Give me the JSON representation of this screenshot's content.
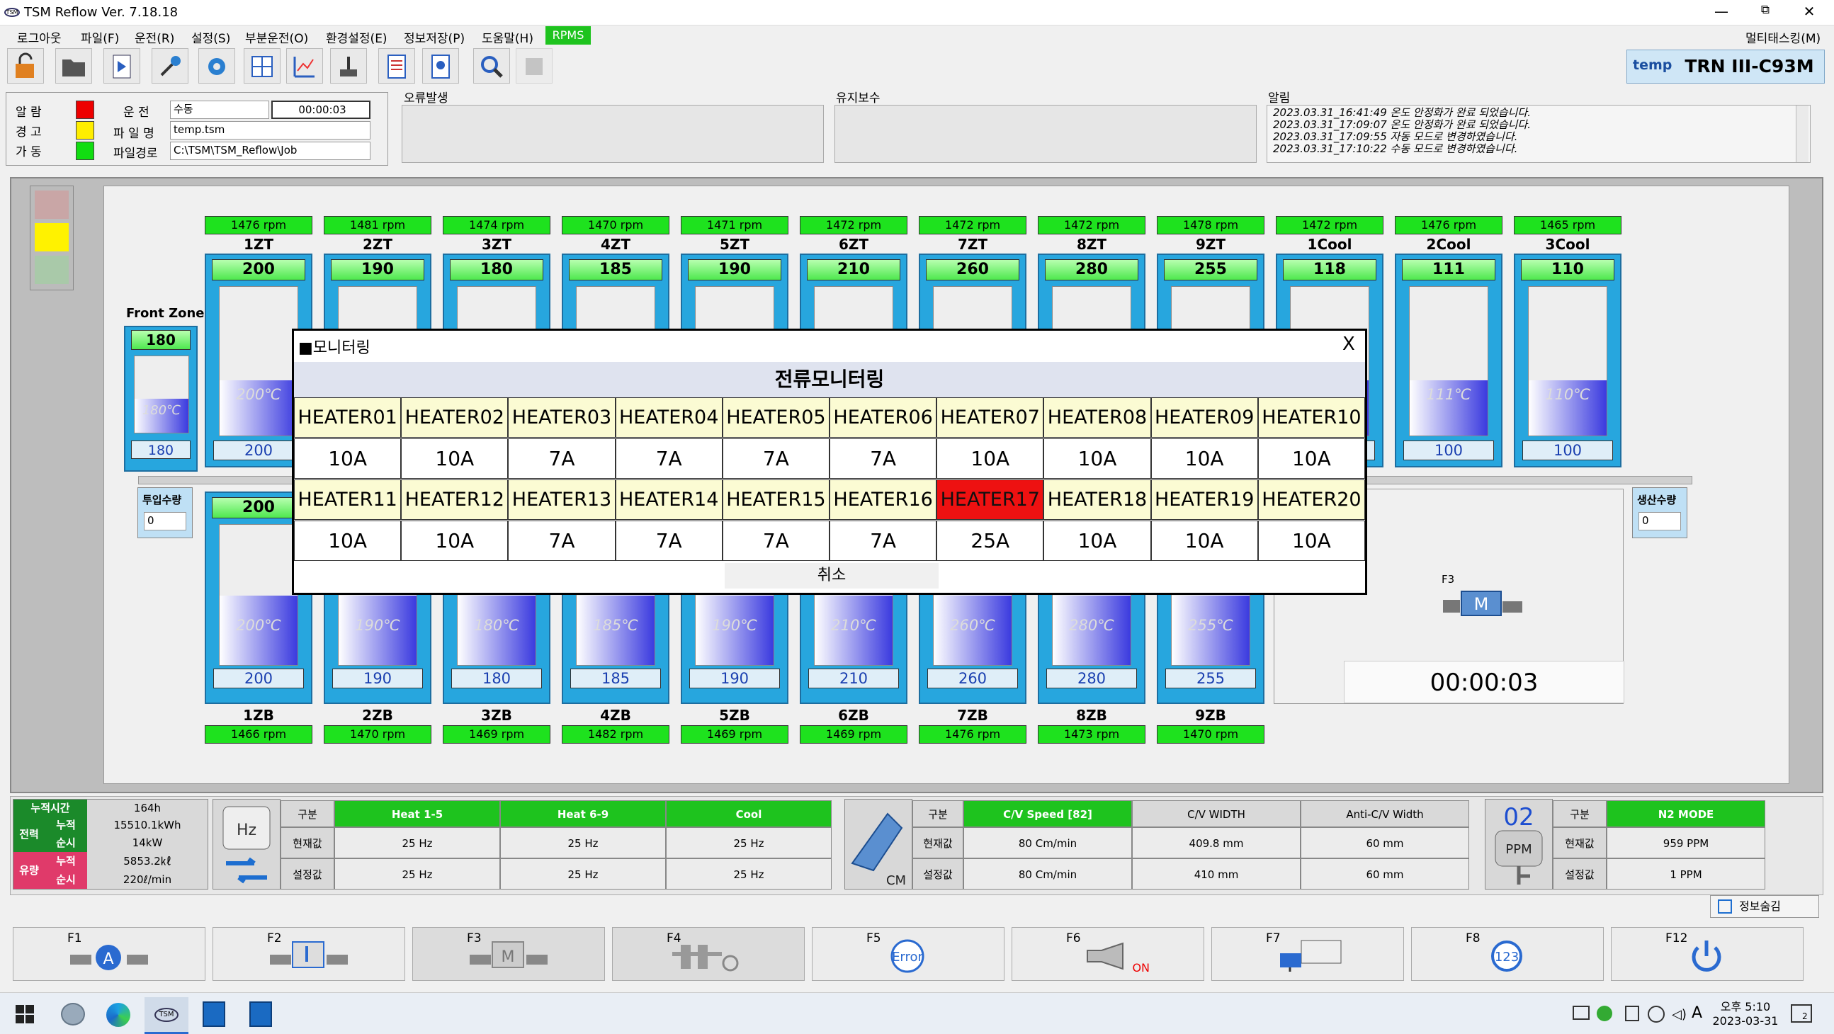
{
  "window": {
    "title": "TSM Reflow Ver. 7.18.18",
    "logo": "TSM",
    "minimize": "—",
    "restore": "⧉",
    "close": "✕"
  },
  "menu": [
    "로그아웃",
    "파일(F)",
    "운전(R)",
    "설정(S)",
    "부분운전(O)",
    "환경설정(E)",
    "정보저장(P)",
    "도움말(H)"
  ],
  "menu_rpms": "RPMS",
  "menu_right": "멀티태스킹(M)",
  "model": {
    "tag": "temp",
    "name": "TRN III-C93M"
  },
  "status": {
    "alarm_label": "알  람",
    "warn_label": "경  고",
    "run_label": "가  동",
    "op_label": "운  전",
    "op_value": "수동",
    "timer": "00:00:03",
    "file_label": "파 일 명",
    "file_value": "temp.tsm",
    "path_label": "파일경로",
    "path_value": "C:\\TSM\\TSM_Reflow\\Job"
  },
  "boxes": {
    "error": "오류발생",
    "maint": "유지보수",
    "notice": "알림"
  },
  "notices": [
    "2023.03.31_16:41:49  온도 안정화가 완료 되었습니다.",
    "2023.03.31_17:09:07  온도 안정화가 완료 되었습니다.",
    "2023.03.31_17:09:55  자동 모드로 변경하였습니다.",
    "2023.03.31_17:10:22  수동 모드로 변경하였습니다."
  ],
  "colors": {
    "alarm": "#ee0000",
    "warn": "#ffee00",
    "run": "#11dd11",
    "rpm": "#1ee21e"
  },
  "front_zone": {
    "label": "Front Zone",
    "sp": "180",
    "pv_text": "180℃",
    "pv": "180"
  },
  "top_zones": [
    {
      "rpm": "1476 rpm",
      "name": "1ZT",
      "sp": "200",
      "pv_text": "200℃",
      "pv": "200"
    },
    {
      "rpm": "1481 rpm",
      "name": "2ZT",
      "sp": "190",
      "pv_text": "",
      "pv": ""
    },
    {
      "rpm": "1474 rpm",
      "name": "3ZT",
      "sp": "180",
      "pv_text": "",
      "pv": ""
    },
    {
      "rpm": "1470 rpm",
      "name": "4ZT",
      "sp": "185",
      "pv_text": "",
      "pv": ""
    },
    {
      "rpm": "1471 rpm",
      "name": "5ZT",
      "sp": "190",
      "pv_text": "",
      "pv": ""
    },
    {
      "rpm": "1472 rpm",
      "name": "6ZT",
      "sp": "210",
      "pv_text": "",
      "pv": ""
    },
    {
      "rpm": "1472 rpm",
      "name": "7ZT",
      "sp": "260",
      "pv_text": "",
      "pv": ""
    },
    {
      "rpm": "1472 rpm",
      "name": "8ZT",
      "sp": "280",
      "pv_text": "",
      "pv": ""
    },
    {
      "rpm": "1478 rpm",
      "name": "9ZT",
      "sp": "255",
      "pv_text": "",
      "pv": ""
    },
    {
      "rpm": "1472 rpm",
      "name": "1Cool",
      "sp": "118",
      "pv_text": "",
      "pv": ""
    },
    {
      "rpm": "1476 rpm",
      "name": "2Cool",
      "sp": "111",
      "pv_text": "111℃",
      "pv": "100"
    },
    {
      "rpm": "1465 rpm",
      "name": "3Cool",
      "sp": "110",
      "pv_text": "110℃",
      "pv": "100"
    }
  ],
  "bottom_zones": [
    {
      "rpm": "1466 rpm",
      "name": "1ZB",
      "sp": "200",
      "pv_text": "200℃",
      "pv": "200"
    },
    {
      "rpm": "1470 rpm",
      "name": "2ZB",
      "sp": "",
      "pv_text": "190℃",
      "pv": "190"
    },
    {
      "rpm": "1469 rpm",
      "name": "3ZB",
      "sp": "",
      "pv_text": "180℃",
      "pv": "180"
    },
    {
      "rpm": "1482 rpm",
      "name": "4ZB",
      "sp": "",
      "pv_text": "185℃",
      "pv": "185"
    },
    {
      "rpm": "1469 rpm",
      "name": "5ZB",
      "sp": "",
      "pv_text": "190℃",
      "pv": "190"
    },
    {
      "rpm": "1469 rpm",
      "name": "6ZB",
      "sp": "",
      "pv_text": "210℃",
      "pv": "210"
    },
    {
      "rpm": "1476 rpm",
      "name": "7ZB",
      "sp": "",
      "pv_text": "260℃",
      "pv": "260"
    },
    {
      "rpm": "1473 rpm",
      "name": "8ZB",
      "sp": "",
      "pv_text": "280℃",
      "pv": "280"
    },
    {
      "rpm": "1470 rpm",
      "name": "9ZB",
      "sp": "",
      "pv_text": "255℃",
      "pv": "255"
    }
  ],
  "counters": {
    "input_label": "투입수량",
    "input_value": "0",
    "output_label": "생산수량",
    "output_value": "0"
  },
  "conveyor": {
    "key": "F3",
    "timer": "00:00:03"
  },
  "modal": {
    "title": "■모니터링",
    "close": "X",
    "subtitle": "전류모니터링",
    "cancel": "취소",
    "heaters": [
      {
        "name": "HEATER01",
        "amp": "10A"
      },
      {
        "name": "HEATER02",
        "amp": "10A"
      },
      {
        "name": "HEATER03",
        "amp": "7A"
      },
      {
        "name": "HEATER04",
        "amp": "7A"
      },
      {
        "name": "HEATER05",
        "amp": "7A"
      },
      {
        "name": "HEATER06",
        "amp": "7A"
      },
      {
        "name": "HEATER07",
        "amp": "10A"
      },
      {
        "name": "HEATER08",
        "amp": "10A"
      },
      {
        "name": "HEATER09",
        "amp": "10A"
      },
      {
        "name": "HEATER10",
        "amp": "10A"
      },
      {
        "name": "HEATER11",
        "amp": "10A"
      },
      {
        "name": "HEATER12",
        "amp": "10A"
      },
      {
        "name": "HEATER13",
        "amp": "7A"
      },
      {
        "name": "HEATER14",
        "amp": "7A"
      },
      {
        "name": "HEATER15",
        "amp": "7A"
      },
      {
        "name": "HEATER16",
        "amp": "7A"
      },
      {
        "name": "HEATER17",
        "amp": "25A",
        "alert": true
      },
      {
        "name": "HEATER18",
        "amp": "10A"
      },
      {
        "name": "HEATER19",
        "amp": "10A"
      },
      {
        "name": "HEATER20",
        "amp": "10A"
      }
    ]
  },
  "energy": {
    "acc_time_label": "누적시간",
    "acc_time": "164h",
    "power_label": "전력",
    "acc_label": "누적",
    "inst_label": "순시",
    "power_acc": "15510.1kWh",
    "power_inst": "14kW",
    "flow_label": "유량",
    "flow_acc": "5853.2㎘",
    "flow_inst": "220ℓ/min"
  },
  "hz_table": {
    "icon": "Hz",
    "h0": "구분",
    "h1": "Heat 1-5",
    "h2": "Heat 6-9",
    "h3": "Cool",
    "r1": "현재값",
    "r2": "설정값",
    "cur": [
      "25 Hz",
      "25 Hz",
      "25 Hz"
    ],
    "set": [
      "25 Hz",
      "25 Hz",
      "25 Hz"
    ]
  },
  "cv_table": {
    "icon": "CM",
    "h0": "구분",
    "h1": "C/V Speed [82]",
    "h2": "C/V WIDTH",
    "h3": "Anti-C/V Width",
    "r1": "현재값",
    "r2": "설정값",
    "cur": [
      "80 Cm/min",
      "409.8 mm",
      "60 mm"
    ],
    "set": [
      "80 Cm/min",
      "410 mm",
      "60 mm"
    ]
  },
  "n2_table": {
    "icon_top": "02",
    "icon": "PPM",
    "h0": "구분",
    "h1": "N2 MODE",
    "r1": "현재값",
    "r2": "설정값",
    "cur": "959 PPM",
    "set": "1 PPM"
  },
  "info_hide": "정보숨김",
  "fkeys": [
    {
      "key": "F1",
      "icon": "A"
    },
    {
      "key": "F2",
      "icon": ""
    },
    {
      "key": "F3",
      "icon": "M"
    },
    {
      "key": "F4",
      "icon": ""
    },
    {
      "key": "F5",
      "icon": "Error"
    },
    {
      "key": "F6",
      "icon": "ON"
    },
    {
      "key": "F7",
      "icon": ""
    },
    {
      "key": "F8",
      "icon": "123"
    },
    {
      "key": "F12",
      "icon": ""
    }
  ],
  "taskbar": {
    "app_label": "TSM",
    "ime": "A",
    "time": "오후 5:10",
    "date": "2023-03-31",
    "badge": "2"
  }
}
